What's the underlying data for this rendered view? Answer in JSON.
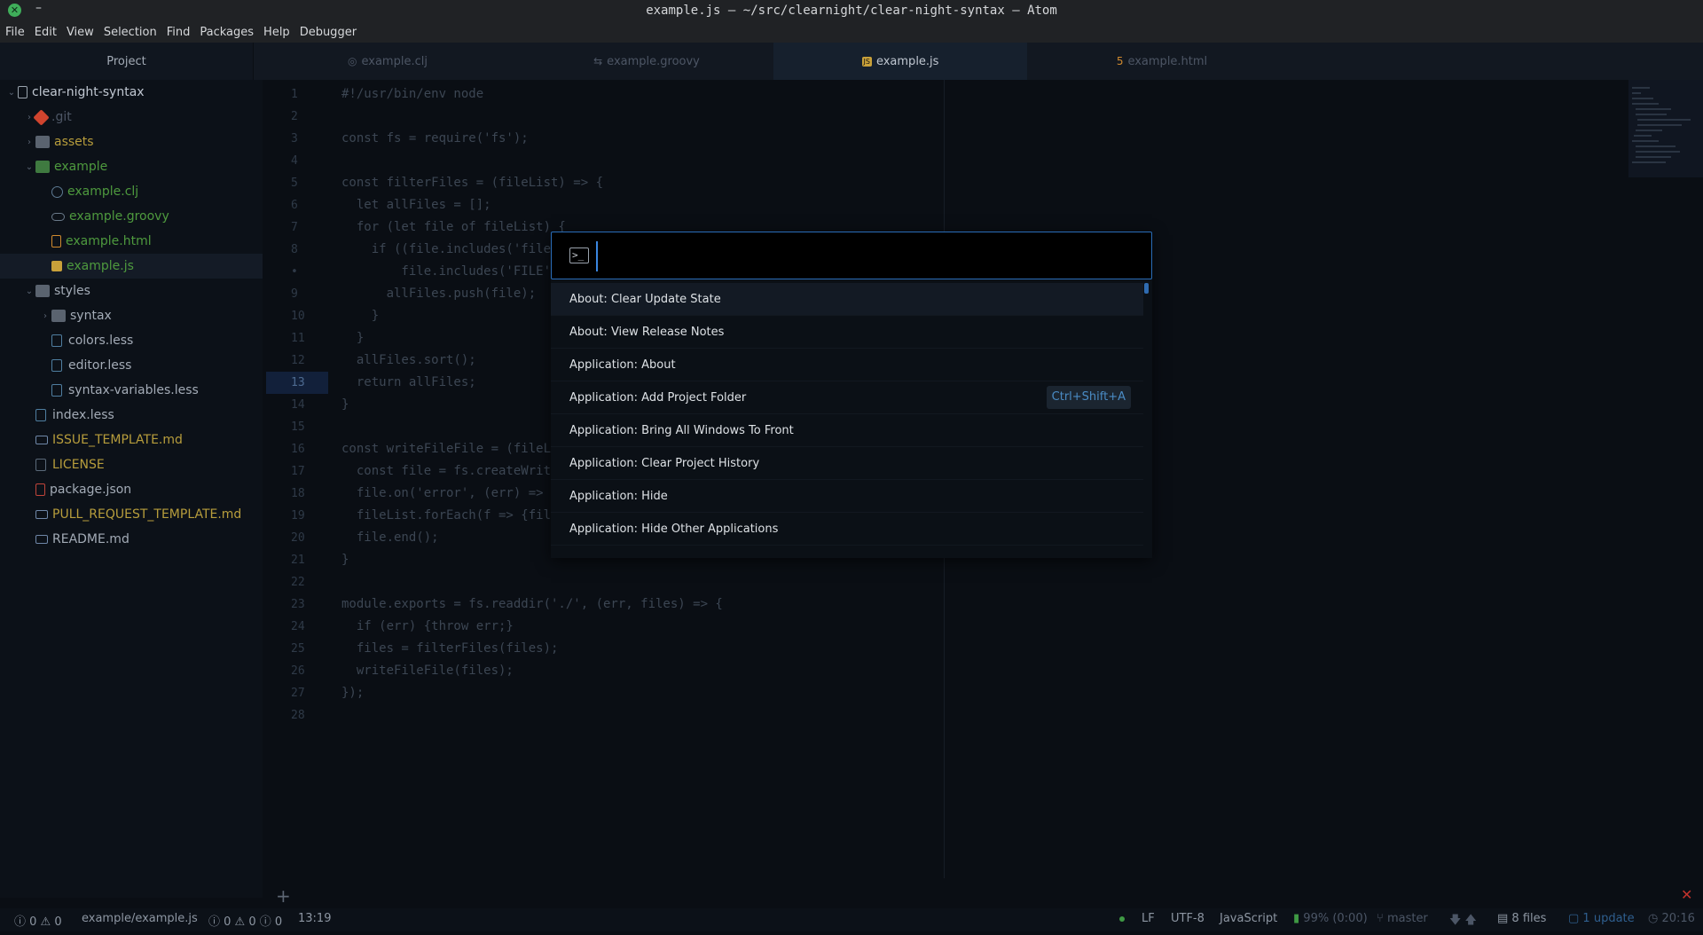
{
  "window": {
    "title": "example.js — ~/src/clearnight/clear-night-syntax — Atom",
    "close_glyph": "✕",
    "minimize_glyph": "–"
  },
  "menu": [
    "File",
    "Edit",
    "View",
    "Selection",
    "Find",
    "Packages",
    "Help",
    "Debugger"
  ],
  "tabs": {
    "project": "Project",
    "files": [
      {
        "label": "example.clj",
        "icon": "clojure-icon",
        "glyph": "◎"
      },
      {
        "label": "example.groovy",
        "icon": "groovy-icon",
        "glyph": "⇆"
      },
      {
        "label": "example.js",
        "icon": "js-icon",
        "glyph": "JS"
      },
      {
        "label": "example.html",
        "icon": "html-icon",
        "glyph": "5"
      }
    ]
  },
  "tree": {
    "root": "clear-night-syntax",
    "items": [
      {
        "label": ".git",
        "kind": "git",
        "color": "#4d5665"
      },
      {
        "label": "assets",
        "kind": "folder",
        "color": "#b79d3c"
      },
      {
        "label": "example",
        "kind": "folder-open",
        "color": "#4e9a3e"
      },
      {
        "label": "example.clj",
        "kind": "clj",
        "color": "#4e9a3e"
      },
      {
        "label": "example.groovy",
        "kind": "groovy",
        "color": "#4e9a3e"
      },
      {
        "label": "example.html",
        "kind": "html",
        "color": "#4e9a3e"
      },
      {
        "label": "example.js",
        "kind": "js",
        "color": "#4e9a3e"
      },
      {
        "label": "styles",
        "kind": "folder",
        "color": "#a3abb6"
      },
      {
        "label": "syntax",
        "kind": "folder",
        "color": "#a3abb6"
      },
      {
        "label": "colors.less",
        "kind": "css",
        "color": "#a3abb6"
      },
      {
        "label": "editor.less",
        "kind": "css",
        "color": "#a3abb6"
      },
      {
        "label": "syntax-variables.less",
        "kind": "css",
        "color": "#a3abb6"
      },
      {
        "label": "index.less",
        "kind": "css",
        "color": "#a3abb6"
      },
      {
        "label": "ISSUE_TEMPLATE.md",
        "kind": "md",
        "color": "#b79d3c"
      },
      {
        "label": "LICENSE",
        "kind": "file",
        "color": "#b79d3c"
      },
      {
        "label": "package.json",
        "kind": "json",
        "color": "#a3abb6"
      },
      {
        "label": "PULL_REQUEST_TEMPLATE.md",
        "kind": "md",
        "color": "#b79d3c"
      },
      {
        "label": "README.md",
        "kind": "md",
        "color": "#a3abb6"
      }
    ]
  },
  "editor": {
    "current_line": 13,
    "lines": [
      "#!/usr/bin/env node",
      "",
      "const fs = require('fs');",
      "",
      "const filterFiles = (fileList) => {",
      "  let allFiles = [];",
      "  for (let file of fileList) {",
      "    if ((file.includes('file",
      "        file.includes('FILE'",
      "      allFiles.push(file);",
      "    }",
      "  }",
      "  allFiles.sort();",
      "  return allFiles;",
      "}",
      "",
      "const writeFileFile = (fileL",
      "  const file = fs.createWrit",
      "  file.on('error', (err) =>",
      "  fileList.forEach(f => {fil",
      "  file.end();",
      "}",
      "",
      "module.exports = fs.readdir('./', (err, files) => {",
      "  if (err) {throw err;}",
      "  files = filterFiles(files);",
      "  writeFileFile(files);",
      "});",
      ""
    ],
    "gutter": [
      "1",
      "2",
      "3",
      "4",
      "5",
      "6",
      "7",
      "8",
      "•",
      "9",
      "10",
      "11",
      "12",
      "13",
      "14",
      "15",
      "16",
      "17",
      "18",
      "19",
      "20",
      "21",
      "22",
      "23",
      "24",
      "25",
      "26",
      "27",
      "28"
    ]
  },
  "palette": {
    "input_value": "",
    "items": [
      {
        "label": "About: Clear Update State",
        "kbd": ""
      },
      {
        "label": "About: View Release Notes",
        "kbd": ""
      },
      {
        "label": "Application: About",
        "kbd": ""
      },
      {
        "label": "Application: Add Project Folder",
        "kbd": "Ctrl+Shift+A"
      },
      {
        "label": "Application: Bring All Windows To Front",
        "kbd": ""
      },
      {
        "label": "Application: Clear Project History",
        "kbd": ""
      },
      {
        "label": "Application: Hide",
        "kbd": ""
      },
      {
        "label": "Application: Hide Other Applications",
        "kbd": ""
      }
    ]
  },
  "bottom": {
    "add_glyph": "+",
    "close_glyph": "✕"
  },
  "status": {
    "errors": "0",
    "warnings": "0",
    "file_path": "example/example.js",
    "linter_errors": "0",
    "linter_warnings": "0",
    "linter_info": "0",
    "cursor": "13:19",
    "line_ending": "LF",
    "encoding": "UTF-8",
    "grammar": "JavaScript",
    "battery": "99% (0:00)",
    "branch": "master",
    "files": "8 files",
    "updates": "1 update",
    "time": "20:16"
  }
}
